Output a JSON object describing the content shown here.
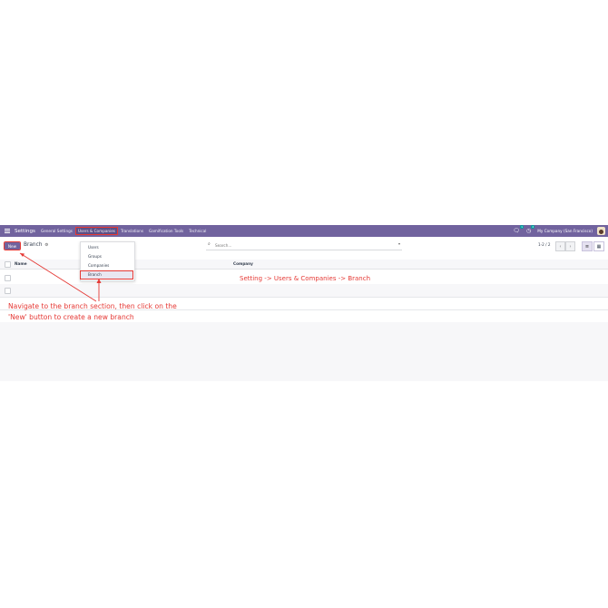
{
  "navbar": {
    "app_title": "Settings",
    "menu": [
      "General Settings",
      "Users & Companies",
      "Translations",
      "Gamification Tools",
      "Technical"
    ],
    "chat_badge": "1",
    "activity_badge": "2",
    "company": "My Company (San Francisco)"
  },
  "control": {
    "new_label": "New",
    "breadcrumb": "Branch",
    "search_placeholder": "Search...",
    "pager": "1-2 / 2"
  },
  "list": {
    "columns": [
      "Name",
      "Company"
    ]
  },
  "dropdown": {
    "items": [
      "Users",
      "Groups",
      "Companies",
      "Branch"
    ]
  },
  "annotations": {
    "path": "Setting -> Users & Companies -> Branch",
    "instruction_line1": "Navigate to the branch section, then click on the",
    "instruction_line2": "'New' button to create a new branch"
  },
  "colors": {
    "navbar": "#71639e",
    "annotation": "#e53935"
  }
}
